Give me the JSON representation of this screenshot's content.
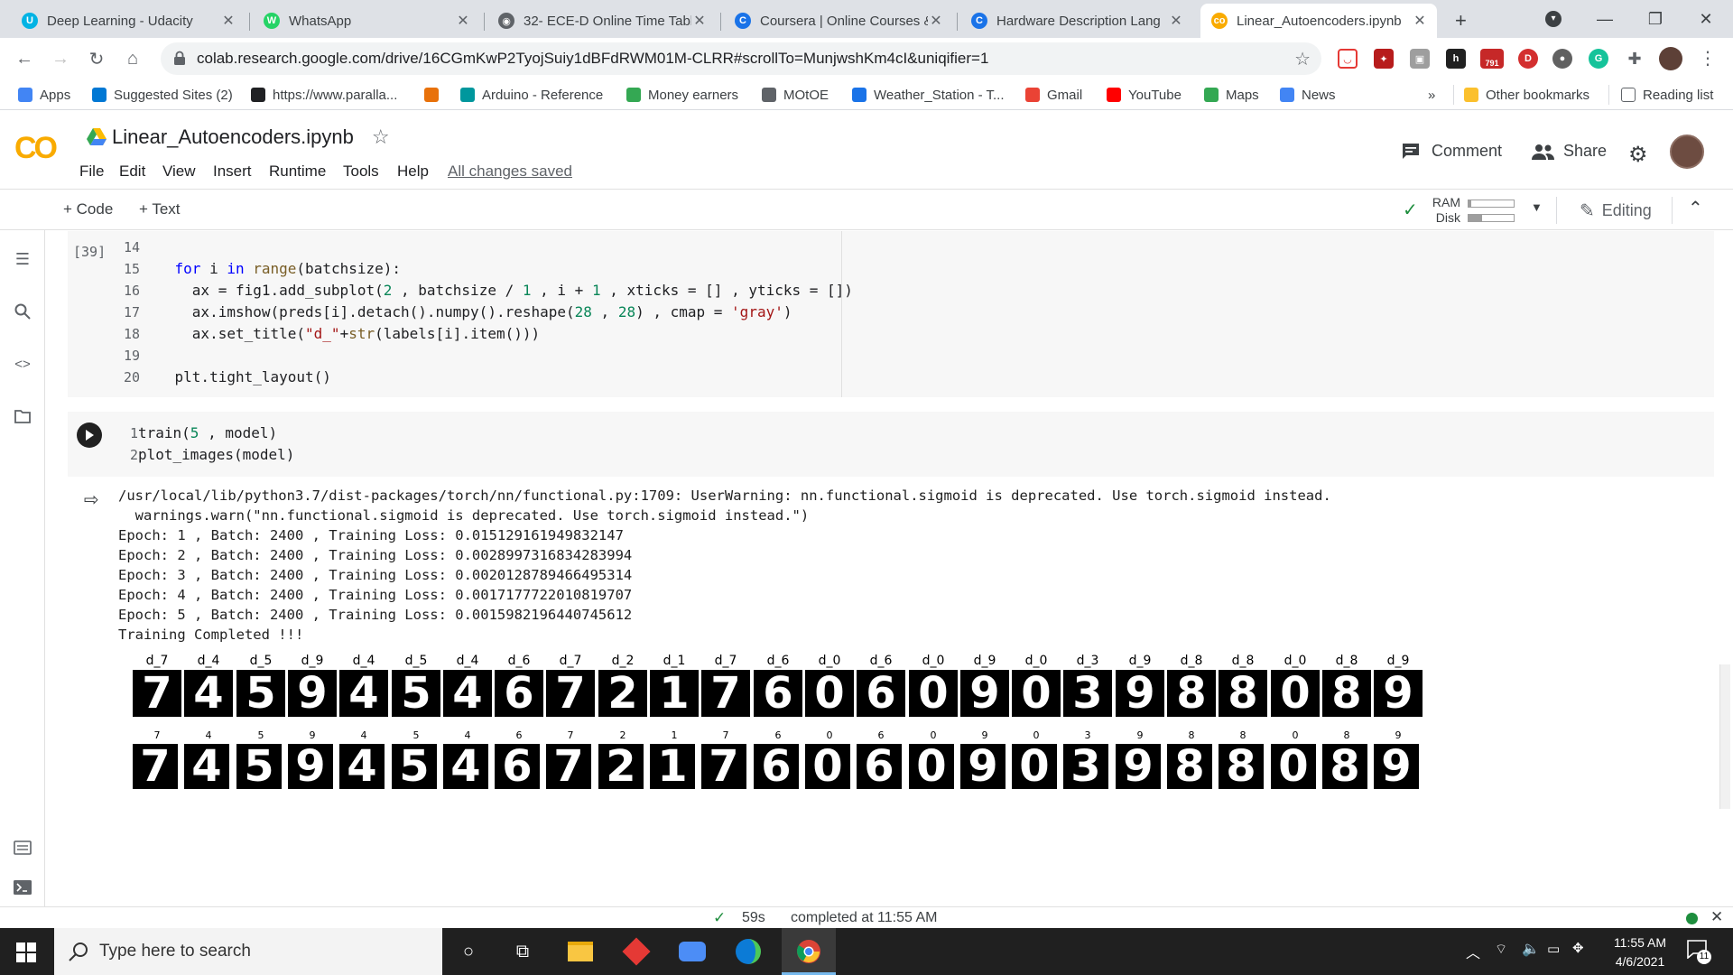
{
  "browser": {
    "tabs": [
      {
        "title": "Deep Learning - Udacity",
        "fav_color": "#02b3e4",
        "fav_glyph": "U"
      },
      {
        "title": "WhatsApp",
        "fav_color": "#25d366",
        "fav_glyph": "W"
      },
      {
        "title": "32- ECE-D Online Time Tabl",
        "fav_color": "#5f6368",
        "fav_glyph": "◉"
      },
      {
        "title": "Coursera | Online Courses &",
        "fav_color": "#1a73e8",
        "fav_glyph": "C"
      },
      {
        "title": "Hardware Description Lang",
        "fav_color": "#1a73e8",
        "fav_glyph": "C"
      },
      {
        "title": "Linear_Autoencoders.ipynb",
        "fav_color": "#f9ab00",
        "fav_glyph": "co"
      }
    ],
    "new_tab_label": "+",
    "url": "colab.research.google.com/drive/16CGmKwP2TyojSuiy1dBFdRWM01M-CLRR#scrollTo=MunjwshKm4cI&uniqifier=1",
    "ext_badge": "791",
    "bookmarks": [
      {
        "label": "Apps",
        "color": "#4285f4"
      },
      {
        "label": "Suggested Sites (2)",
        "color": "#0078d4"
      },
      {
        "label": "https://www.paralla...",
        "color": "#202124"
      },
      {
        "label": "",
        "color": "#e8710a"
      },
      {
        "label": "Arduino - Reference",
        "color": "#00979d"
      },
      {
        "label": "Money earners",
        "color": "#34a853"
      },
      {
        "label": "MOtOE",
        "color": "#5f6368"
      },
      {
        "label": "Weather_Station - T...",
        "color": "#1a73e8"
      },
      {
        "label": "Gmail",
        "color": "#ea4335"
      },
      {
        "label": "YouTube",
        "color": "#ff0000"
      },
      {
        "label": "Maps",
        "color": "#34a853"
      },
      {
        "label": "News",
        "color": "#4285f4"
      }
    ],
    "more_bookmarks": "»",
    "other_bookmarks": "Other bookmarks",
    "reading_list": "Reading list"
  },
  "colab": {
    "logo": "CO",
    "notebook_title": "Linear_Autoencoders.ipynb",
    "menu": [
      "File",
      "Edit",
      "View",
      "Insert",
      "Runtime",
      "Tools",
      "Help"
    ],
    "save_status": "All changes saved",
    "comment_label": "Comment",
    "share_label": "Share",
    "add_code": "+ Code",
    "add_text": "+ Text",
    "ram_label": "RAM",
    "disk_label": "Disk",
    "editing_label": "Editing"
  },
  "cell1": {
    "exec_count": "[39]",
    "lines": [
      {
        "n": "14",
        "code": ""
      },
      {
        "n": "15",
        "code": "    for i in range(batchsize):"
      },
      {
        "n": "16",
        "code": "      ax = fig1.add_subplot(2 , batchsize / 1 , i + 1 , xticks = [] , yticks = [])"
      },
      {
        "n": "17",
        "code": "      ax.imshow(preds[i].detach().numpy().reshape(28 , 28) , cmap = 'gray')"
      },
      {
        "n": "18",
        "code": "      ax.set_title(\"d_\"+str(labels[i].item()))"
      },
      {
        "n": "19",
        "code": ""
      },
      {
        "n": "20",
        "code": "    plt.tight_layout()"
      }
    ]
  },
  "cell2": {
    "lines": [
      {
        "n": "1",
        "code": "train(5 , model)"
      },
      {
        "n": "2",
        "code": "plot_images(model)"
      }
    ],
    "output": [
      "/usr/local/lib/python3.7/dist-packages/torch/nn/functional.py:1709: UserWarning: nn.functional.sigmoid is deprecated. Use torch.sigmoid instead.",
      "  warnings.warn(\"nn.functional.sigmoid is deprecated. Use torch.sigmoid instead.\")",
      "Epoch: 1 , Batch: 2400 , Training Loss: 0.015129161949832147",
      "Epoch: 2 , Batch: 2400 , Training Loss: 0.0028997316834283994",
      "Epoch: 3 , Batch: 2400 , Training Loss: 0.0020128789466495314",
      "Epoch: 4 , Batch: 2400 , Training Loss: 0.0017177722010819707",
      "Epoch: 5 , Batch: 2400 , Training Loss: 0.0015982196440745612",
      "Training Completed !!!"
    ],
    "top_titles": [
      "d_7",
      "d_4",
      "d_5",
      "d_9",
      "d_4",
      "d_5",
      "d_4",
      "d_6",
      "d_7",
      "d_2",
      "d_1",
      "d_7",
      "d_6",
      "d_0",
      "d_6",
      "d_0",
      "d_9",
      "d_0",
      "d_3",
      "d_9",
      "d_8",
      "d_8",
      "d_0",
      "d_8",
      "d_9"
    ],
    "digits": [
      "7",
      "4",
      "5",
      "9",
      "4",
      "5",
      "4",
      "6",
      "7",
      "2",
      "1",
      "7",
      "6",
      "0",
      "6",
      "0",
      "9",
      "0",
      "3",
      "9",
      "8",
      "8",
      "0",
      "8",
      "9"
    ],
    "bottom_titles": [
      "7",
      "4",
      "5",
      "9",
      "4",
      "5",
      "4",
      "6",
      "7",
      "2",
      "1",
      "7",
      "6",
      "0",
      "6",
      "0",
      "9",
      "0",
      "3",
      "9",
      "8",
      "8",
      "0",
      "8",
      "9"
    ]
  },
  "statusbar": {
    "duration": "59s",
    "completed": "completed at 11:55 AM"
  },
  "taskbar": {
    "search_placeholder": "Type here to search",
    "time": "11:55 AM",
    "date": "4/6/2021",
    "notif_count": "11"
  }
}
